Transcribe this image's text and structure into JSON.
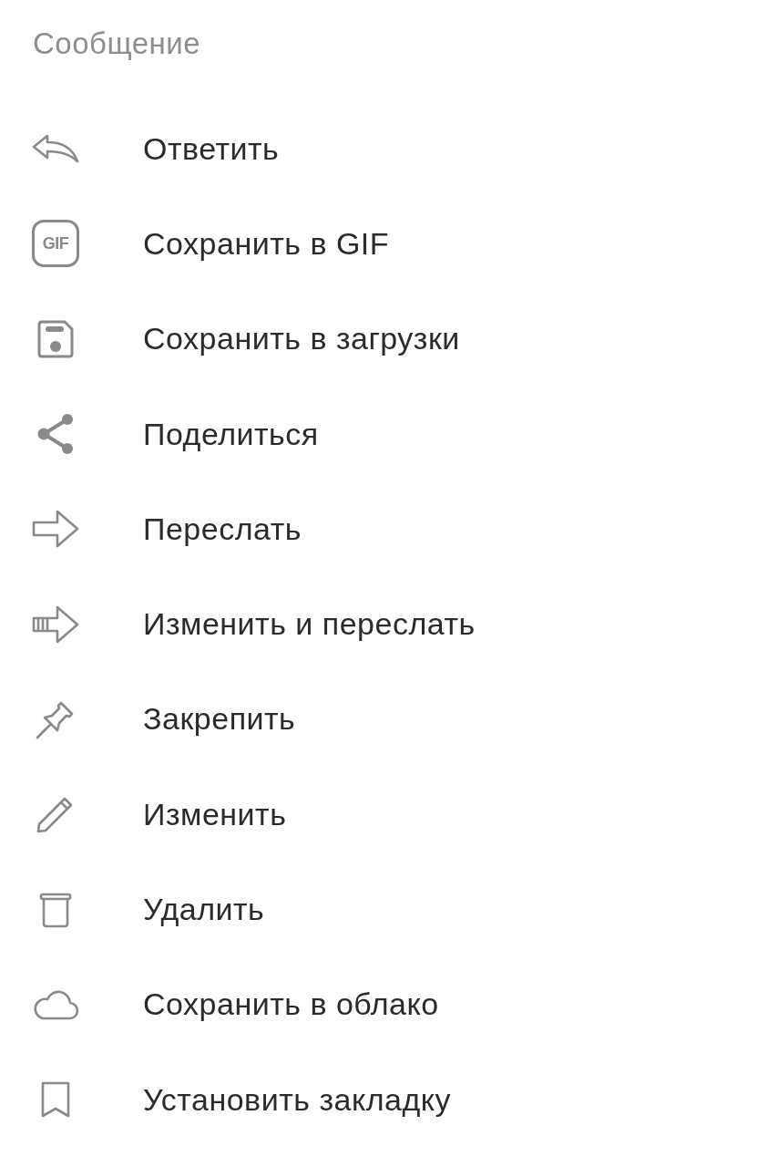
{
  "header": {
    "title": "Сообщение"
  },
  "menu": {
    "items": [
      {
        "kind": "reply",
        "label": "Ответить"
      },
      {
        "kind": "gif",
        "badge": "GIF",
        "label": "Сохранить в GIF"
      },
      {
        "kind": "save",
        "label": "Сохранить в загрузки"
      },
      {
        "kind": "share",
        "label": "Поделиться"
      },
      {
        "kind": "forward",
        "label": "Переслать"
      },
      {
        "kind": "edit-forward",
        "label": "Изменить и переслать"
      },
      {
        "kind": "pin",
        "label": "Закрепить"
      },
      {
        "kind": "edit",
        "label": "Изменить"
      },
      {
        "kind": "delete",
        "label": "Удалить"
      },
      {
        "kind": "cloud",
        "label": "Сохранить в облако"
      },
      {
        "kind": "bookmark",
        "label": "Установить закладку"
      }
    ]
  }
}
